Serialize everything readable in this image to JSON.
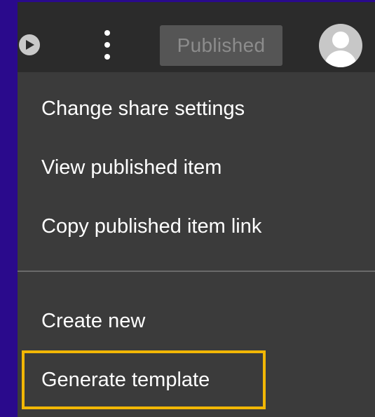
{
  "topbar": {
    "status_badge": "Published",
    "icons": {
      "play": "play-circle-icon",
      "more": "more-vertical-icon",
      "avatar": "user-avatar-icon"
    }
  },
  "menu": {
    "items": [
      {
        "label": "Change share settings"
      },
      {
        "label": "View published item"
      },
      {
        "label": "Copy published item link"
      },
      {
        "label": "Create new"
      },
      {
        "label": "Generate template"
      }
    ]
  },
  "colors": {
    "background": "#2a0a8c",
    "menu_background": "#3b3b3b",
    "topbar_background": "#2b2b2b",
    "highlight": "#f2b705",
    "text": "#ffffff"
  }
}
